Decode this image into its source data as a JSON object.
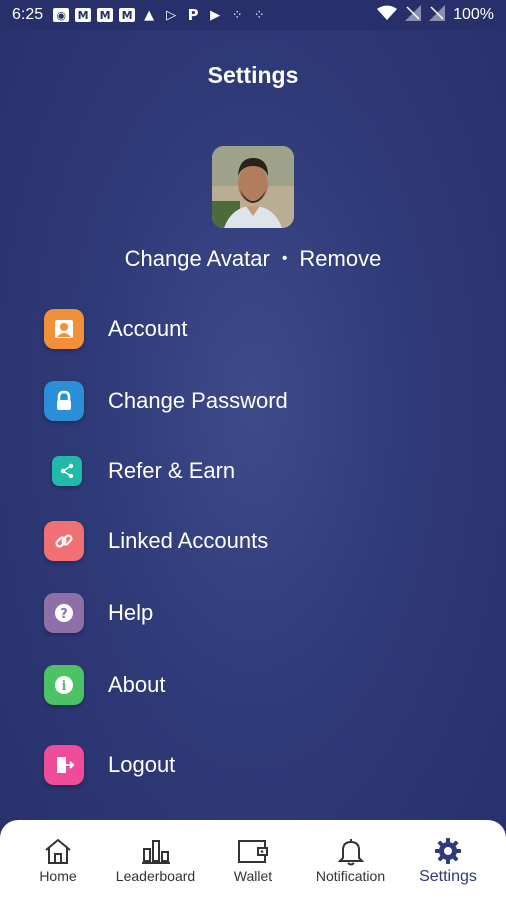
{
  "status_bar": {
    "time": "6:25",
    "battery": "100%"
  },
  "page": {
    "title": "Settings"
  },
  "avatar_actions": {
    "change": "Change Avatar",
    "separator": "•",
    "remove": "Remove"
  },
  "menu": {
    "items": [
      {
        "label": "Account",
        "icon": "person-icon",
        "color": "#f0913a"
      },
      {
        "label": "Change Password",
        "icon": "lock-icon",
        "color": "#2b8fd8"
      },
      {
        "label": "Refer & Earn",
        "icon": "share-icon",
        "color": "#21b9a7"
      },
      {
        "label": "Linked Accounts",
        "icon": "link-icon",
        "color": "#f07074"
      },
      {
        "label": "Help",
        "icon": "question-icon",
        "color": "#8e6fa8"
      },
      {
        "label": "About",
        "icon": "info-icon",
        "color": "#4cc264"
      },
      {
        "label": "Logout",
        "icon": "logout-icon",
        "color": "#ef4d99"
      }
    ]
  },
  "bottom_nav": {
    "items": [
      {
        "label": "Home",
        "icon": "home-icon"
      },
      {
        "label": "Leaderboard",
        "icon": "leaderboard-icon"
      },
      {
        "label": "Wallet",
        "icon": "wallet-icon"
      },
      {
        "label": "Notification",
        "icon": "bell-icon"
      },
      {
        "label": "Settings",
        "icon": "gear-icon",
        "active": true
      }
    ]
  },
  "colors": {
    "background": "#2f3a78",
    "active_nav": "#2f3a7a"
  }
}
